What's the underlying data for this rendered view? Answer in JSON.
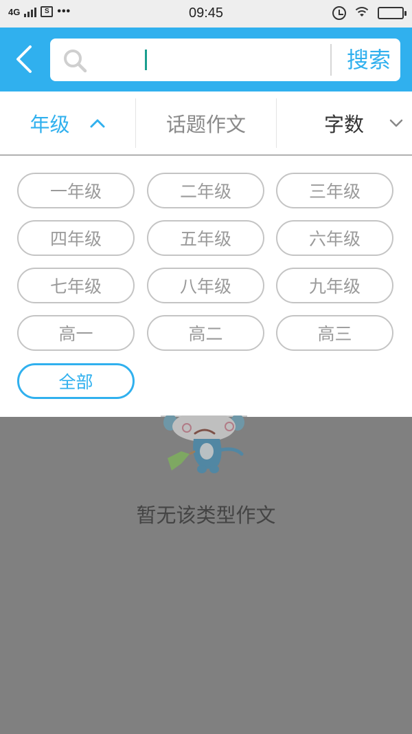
{
  "status_bar": {
    "network": "4G",
    "time": "09:45",
    "icons": [
      "signal-icon",
      "sim-icon",
      "more-dots-icon",
      "alarm-icon",
      "wifi-icon",
      "battery-icon"
    ]
  },
  "header": {
    "back_icon": "chevron-left-icon",
    "search": {
      "value": "",
      "placeholder": "",
      "icon": "search-icon",
      "button_label": "搜索"
    }
  },
  "filters": {
    "grade": {
      "label": "年级",
      "icon": "chevron-up-icon",
      "active": true
    },
    "topic": {
      "label": "话题作文"
    },
    "words": {
      "label": "字数",
      "icon": "chevron-down-icon"
    }
  },
  "grade_options": [
    {
      "label": "一年级",
      "selected": false
    },
    {
      "label": "二年级",
      "selected": false
    },
    {
      "label": "三年级",
      "selected": false
    },
    {
      "label": "四年级",
      "selected": false
    },
    {
      "label": "五年级",
      "selected": false
    },
    {
      "label": "六年级",
      "selected": false
    },
    {
      "label": "七年级",
      "selected": false
    },
    {
      "label": "八年级",
      "selected": false
    },
    {
      "label": "九年级",
      "selected": false
    },
    {
      "label": "高一",
      "selected": false
    },
    {
      "label": "高二",
      "selected": false
    },
    {
      "label": "高三",
      "selected": false
    },
    {
      "label": "全部",
      "selected": true
    }
  ],
  "empty_state": {
    "icon": "sad-mascot-icon",
    "message": "暂无该类型作文"
  },
  "colors": {
    "accent": "#30b0ee",
    "overlay": "#808080",
    "chip_border": "#c4c4c4",
    "chip_text": "#9a9a9a",
    "caret": "#1a9e8f"
  }
}
